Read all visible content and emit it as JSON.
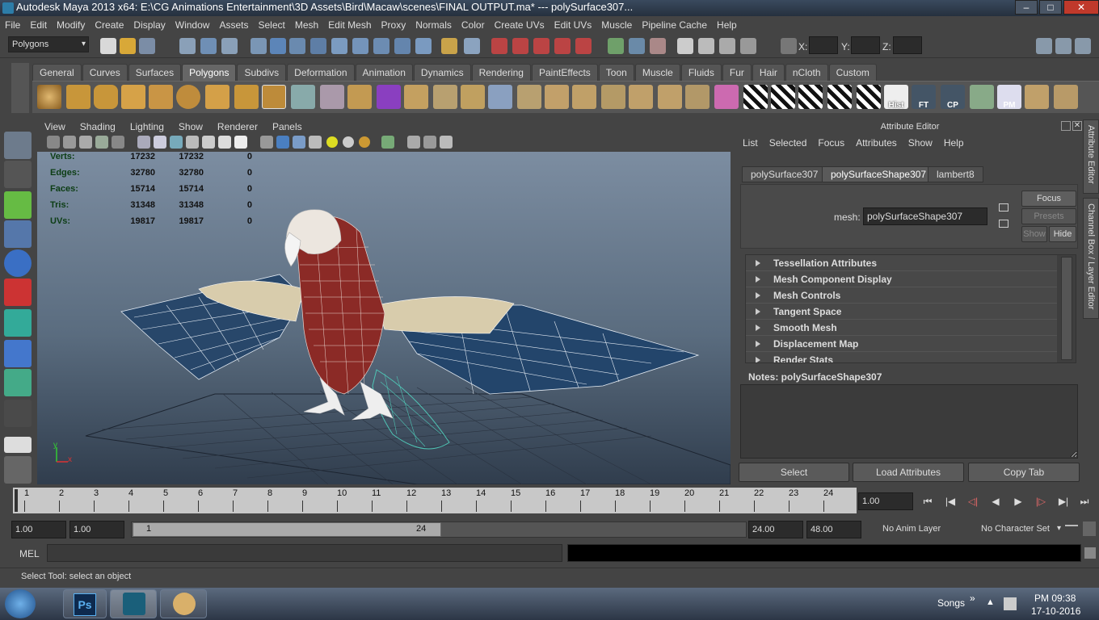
{
  "window": {
    "title": "Autodesk Maya 2013 x64: E:\\CG Animations Entertainment\\3D Assets\\Bird\\Macaw\\scenes\\FINAL OUTPUT.ma*   ---   polySurface307..."
  },
  "menubar": [
    "File",
    "Edit",
    "Modify",
    "Create",
    "Display",
    "Window",
    "Assets",
    "Select",
    "Mesh",
    "Edit Mesh",
    "Proxy",
    "Normals",
    "Color",
    "Create UVs",
    "Edit UVs",
    "Muscle",
    "Pipeline Cache",
    "Help"
  ],
  "statusline": {
    "mode": "Polygons",
    "x_label": "X:",
    "y_label": "Y:",
    "z_label": "Z:"
  },
  "shelf": {
    "tabs": [
      "General",
      "Curves",
      "Surfaces",
      "Polygons",
      "Subdivs",
      "Deformation",
      "Animation",
      "Dynamics",
      "Rendering",
      "PaintEffects",
      "Toon",
      "Muscle",
      "Fluids",
      "Fur",
      "Hair",
      "nCloth",
      "Custom"
    ],
    "active": "Polygons",
    "labels": {
      "hist": "Hist",
      "ft": "FT",
      "cp": "CP",
      "pm": "PM"
    }
  },
  "viewport": {
    "menu": [
      "View",
      "Shading",
      "Lighting",
      "Show",
      "Renderer",
      "Panels"
    ],
    "hud": [
      {
        "label": "Verts:",
        "a": "17232",
        "b": "17232",
        "c": "0"
      },
      {
        "label": "Edges:",
        "a": "32780",
        "b": "32780",
        "c": "0"
      },
      {
        "label": "Faces:",
        "a": "15714",
        "b": "15714",
        "c": "0"
      },
      {
        "label": "Tris:",
        "a": "31348",
        "b": "31348",
        "c": "0"
      },
      {
        "label": "UVs:",
        "a": "19817",
        "b": "19817",
        "c": "0"
      }
    ],
    "axis": {
      "x": "x",
      "y": "y"
    }
  },
  "attribute_editor": {
    "title": "Attribute Editor",
    "menu": [
      "List",
      "Selected",
      "Focus",
      "Attributes",
      "Show",
      "Help"
    ],
    "tabs": [
      "polySurface307",
      "polySurfaceShape307",
      "lambert8"
    ],
    "active_tab": "polySurfaceShape307",
    "mesh_label": "mesh:",
    "mesh_value": "polySurfaceShape307",
    "buttons": {
      "focus": "Focus",
      "presets": "Presets",
      "show": "Show",
      "hide": "Hide"
    },
    "sections": [
      "Tessellation Attributes",
      "Mesh Component Display",
      "Mesh Controls",
      "Tangent Space",
      "Smooth Mesh",
      "Displacement Map",
      "Render Stats"
    ],
    "notes_label": "Notes:  polySurfaceShape307",
    "bottom_buttons": [
      "Select",
      "Load Attributes",
      "Copy Tab"
    ]
  },
  "side_tabs": [
    "Attribute Editor",
    "Channel Box / Layer Editor"
  ],
  "timeline": {
    "ticks": [
      "1",
      "2",
      "3",
      "4",
      "5",
      "6",
      "7",
      "8",
      "9",
      "10",
      "11",
      "12",
      "13",
      "14",
      "15",
      "16",
      "17",
      "18",
      "19",
      "20",
      "21",
      "22",
      "23",
      "24"
    ],
    "current_frame": "1.00"
  },
  "range": {
    "start": "1.00",
    "playback_start": "1.00",
    "slider_start": "1",
    "slider_end": "24",
    "playback_end": "24.00",
    "end": "48.00",
    "anim_layer": "No Anim Layer",
    "char_set": "No Character Set"
  },
  "cmdline": {
    "label": "MEL"
  },
  "helpline": {
    "text": "Select Tool: select an object"
  },
  "taskbar": {
    "songs": "Songs",
    "time": "PM 09:38",
    "date": "17-10-2016",
    "ps": "Ps"
  }
}
